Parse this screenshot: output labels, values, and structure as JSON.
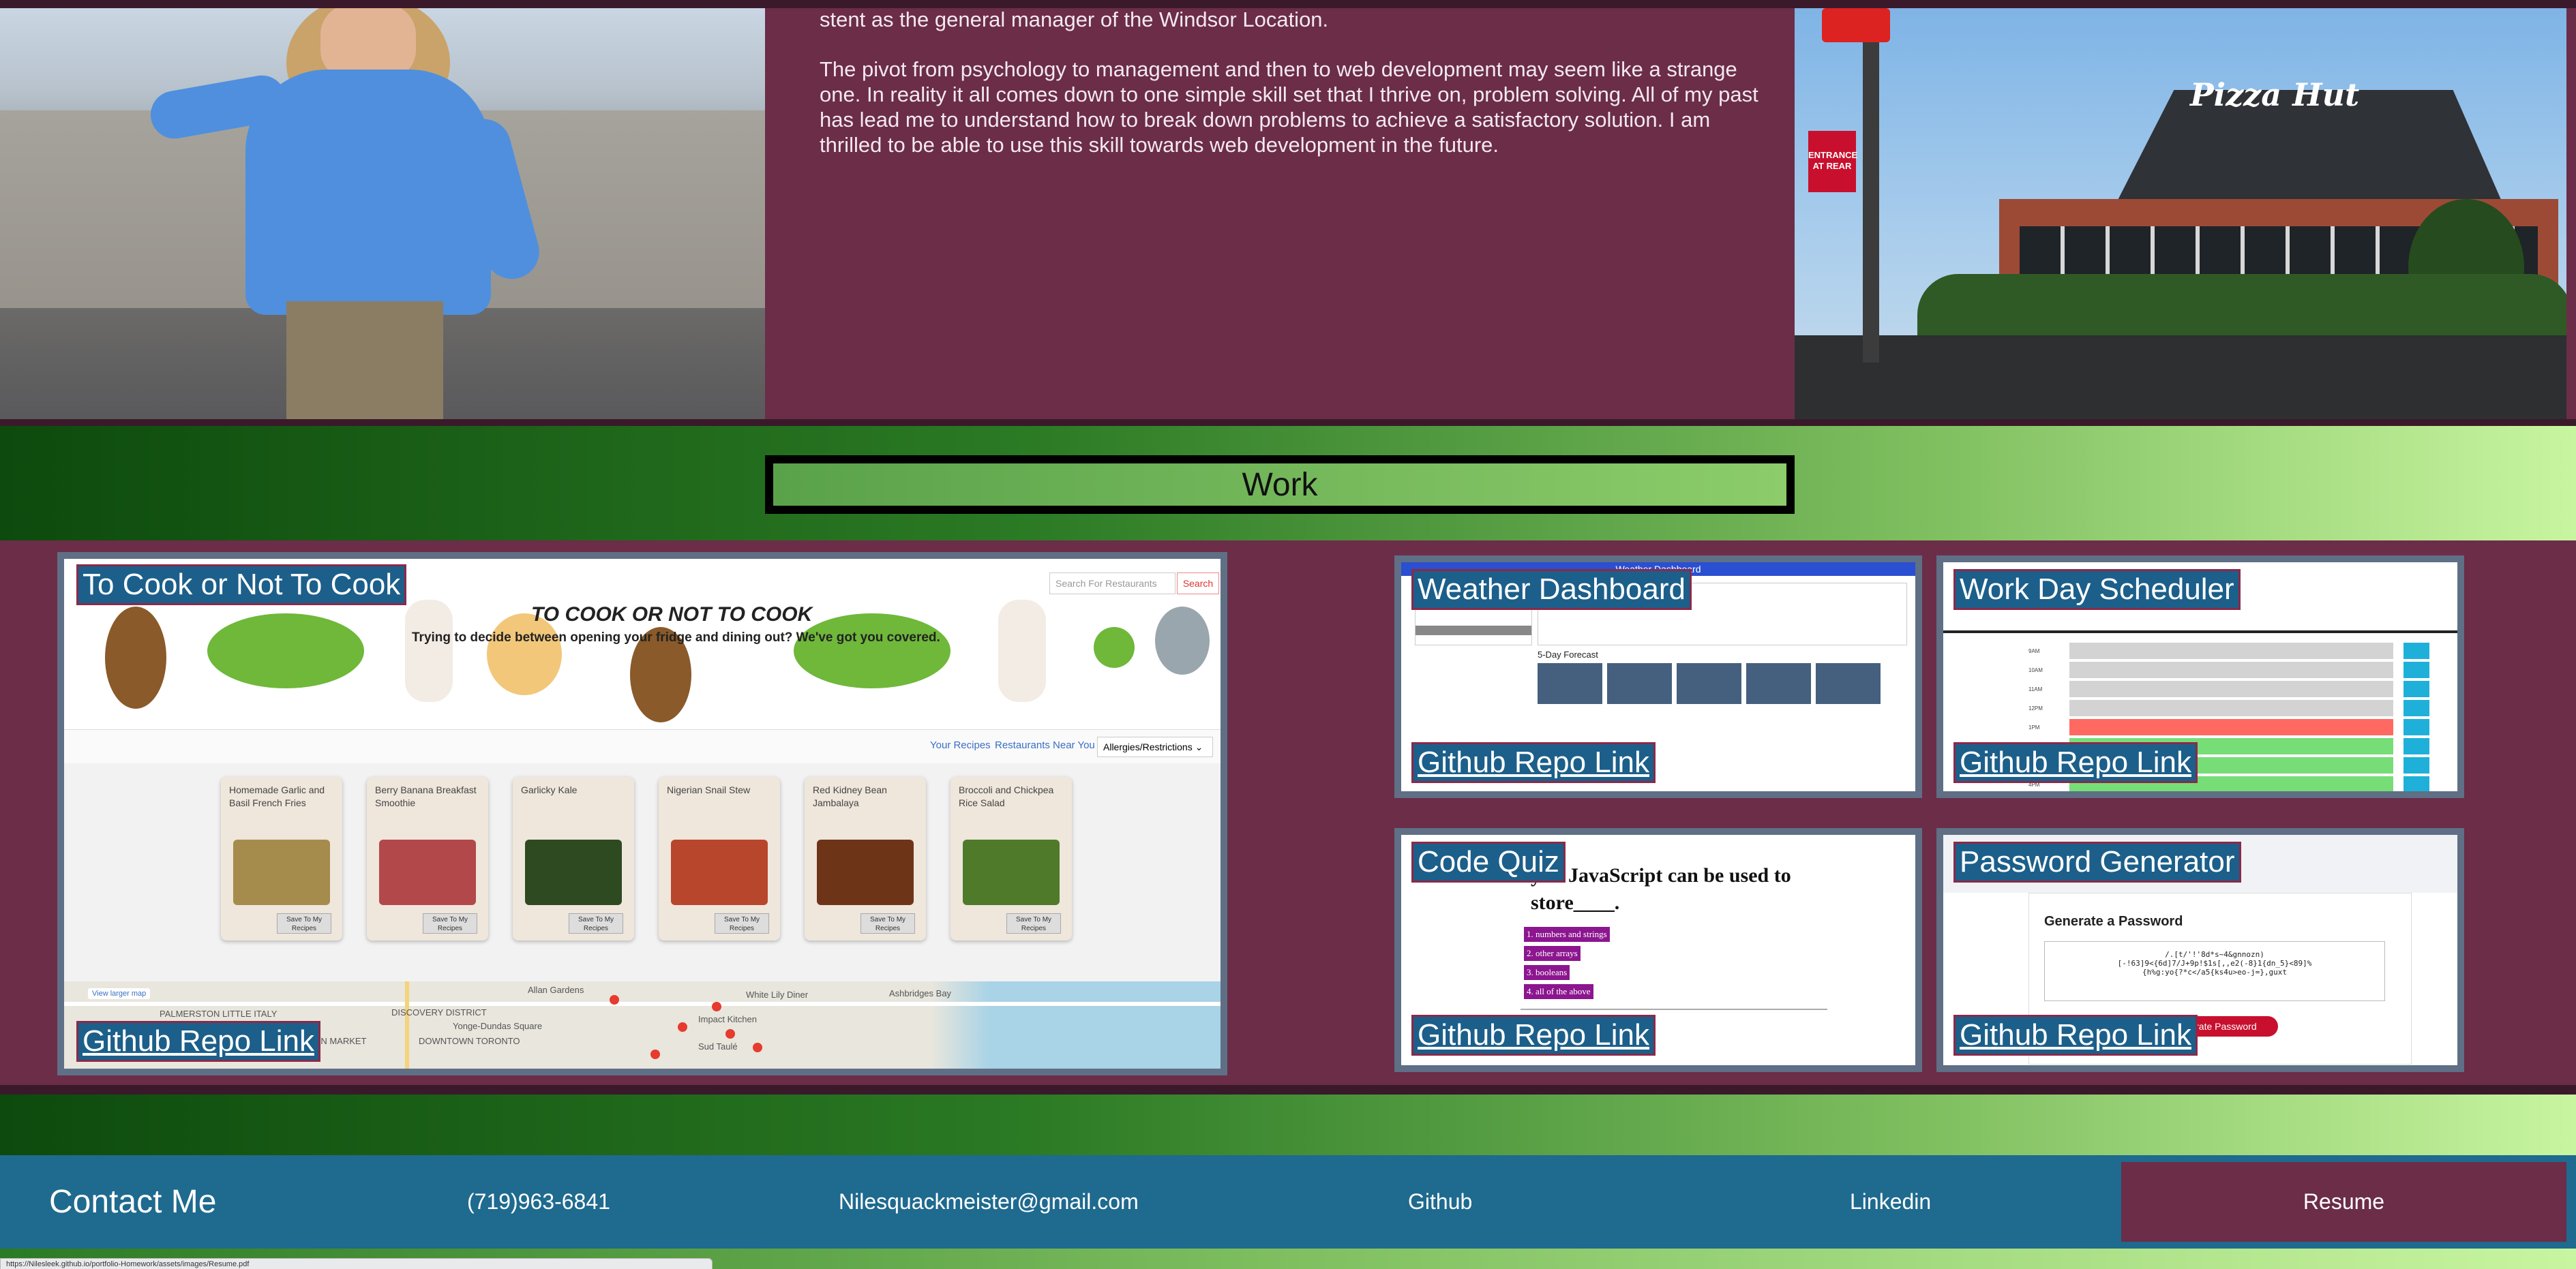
{
  "about": {
    "paragraph1_tail": "stent as the general manager of the Windsor Location.",
    "paragraph2": "The pivot from psychology to management and then to web development may seem like a strange one. In reality it all comes down to one simple skill set that I thrive on, problem solving. All of my past has lead me to understand how to break down problems to achieve a satisfactory solution. I am thrilled to be able to use this skill towards web development in the future.",
    "pizzahut_logo_text": "Pizza Hut",
    "pizzahut_entrance_sign": "ENTRANCE AT REAR"
  },
  "work": {
    "title": "Work",
    "projects": [
      {
        "title": "To Cook or Not To Cook",
        "link": "Github Repo Link",
        "preview": {
          "hero_title": "TO COOK OR NOT TO COOK",
          "hero_subtitle": "Trying to decide between opening your fridge and dining out? We've got you covered.",
          "search_placeholder": "Search For Restaurants",
          "search_button": "Search",
          "nav_your_recipes": "Your Recipes",
          "nav_restaurants": "Restaurants Near You",
          "allergies_select": "Allergies/Restrictions ⌄",
          "recipes": [
            {
              "name": "Homemade Garlic and Basil French Fries",
              "save": "Save To My Recipes",
              "color": "#a58c4c"
            },
            {
              "name": "Berry Banana Breakfast Smoothie",
              "save": "Save To My Recipes",
              "color": "#b2484a"
            },
            {
              "name": "Garlicky Kale",
              "save": "Save To My Recipes",
              "color": "#2e4a20"
            },
            {
              "name": "Nigerian Snail Stew",
              "save": "Save To My Recipes",
              "color": "#b8462c"
            },
            {
              "name": "Red Kidney Bean Jambalaya",
              "save": "Save To My Recipes",
              "color": "#6e3418"
            },
            {
              "name": "Broccoli and Chickpea Rice Salad",
              "save": "Save To My Recipes",
              "color": "#4f7a2a"
            }
          ],
          "map_view_larger": "View larger map",
          "map_labels": [
            "PALMERSTON LITTLE ITALY",
            "DISCOVERY DISTRICT",
            "KENSINGTON MARKET",
            "DOWNTOWN TORONTO",
            "Yonge-Dundas Square",
            "Allan Gardens",
            "White Lily Diner",
            "Impact Kitchen",
            "Sud Taulé",
            "Ashbridges Bay"
          ]
        }
      },
      {
        "title": "Weather Dashboard",
        "link": "Github Repo Link",
        "preview": {
          "header": "Weather Dashboard",
          "forecast_label": "5-Day Forecast"
        }
      },
      {
        "title": "Work Day Scheduler",
        "link": "Github Repo Link",
        "preview": {
          "header_visible": "eduler",
          "hours": [
            "9AM",
            "10AM",
            "11AM",
            "12PM",
            "1PM",
            "2PM",
            "3PM",
            "4PM"
          ]
        }
      },
      {
        "title": "Code Quiz",
        "link": "Github Repo Link",
        "preview": {
          "question_visible": "y in JavaScript can be used to store____.",
          "answers": [
            "1. numbers and strings",
            "2. other arrays",
            "3. booleans",
            "4. all of the above"
          ]
        }
      },
      {
        "title": "Password Generator",
        "link": "Github Repo Link",
        "preview": {
          "header_visible": "erator",
          "generate_label": "Generate a Password",
          "password_output": "/.[t/'!'8d*s~4&gnnozn)\n[-!63]9<{6d]7/J+9p!$1s[,,e2(-8}1{dn_5}<89]%\n{h%g:yo{?*c</a5{ks4u>eo-j=},guxt",
          "button_visible": "erate Password"
        }
      }
    ]
  },
  "footer": {
    "contact": "Contact Me",
    "phone": "(719)963-6841",
    "email": "Nilesquackmeister@gmail.com",
    "github": "Github",
    "linkedin": "Linkedin",
    "resume": "Resume"
  },
  "status_url": "https://Nilesleek.github.io/portfolio-Homework/assets/images/Resume.pdf",
  "colors": {
    "section_bg": "#6b2d48",
    "card_label_bg": "#1c5f8a",
    "footer_bg": "#1f6a8f",
    "resume_bg": "#6b2d48"
  }
}
